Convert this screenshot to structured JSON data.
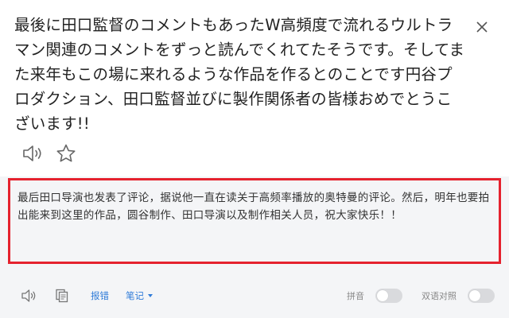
{
  "source": {
    "text": "最後に田口監督のコメントもあったW高頻度で流れるウルトラマン関連のコメントをずっと読んでくれてたそうです。そしてまた来年もこの場に来れるような作品を作るとのことです円谷プロダクション、田口監督並びに製作関係者の皆様おめでとうこざいます!!",
    "speaker_icon": "speaker-icon",
    "star_icon": "star-icon",
    "close_icon": "close-icon"
  },
  "result": {
    "text": "最后田口导演也发表了评论，据说他一直在读关于高频率播放的奥特曼的评论。然后，明年也要拍出能来到这里的作品，圆谷制作、田口导演以及制作相关人员，祝大家快乐！！",
    "highlight_color": "#e5222e"
  },
  "toolbar": {
    "speaker_icon": "speaker-icon",
    "copy_icon": "copy-icon",
    "report_label": "报错",
    "notes_label": "笔记",
    "pinyin_label": "拼音",
    "bilingual_label": "双语对照",
    "pinyin_on": false,
    "bilingual_on": false
  },
  "colors": {
    "link": "#2f7bd8",
    "result_bg": "#f4f5f7"
  }
}
